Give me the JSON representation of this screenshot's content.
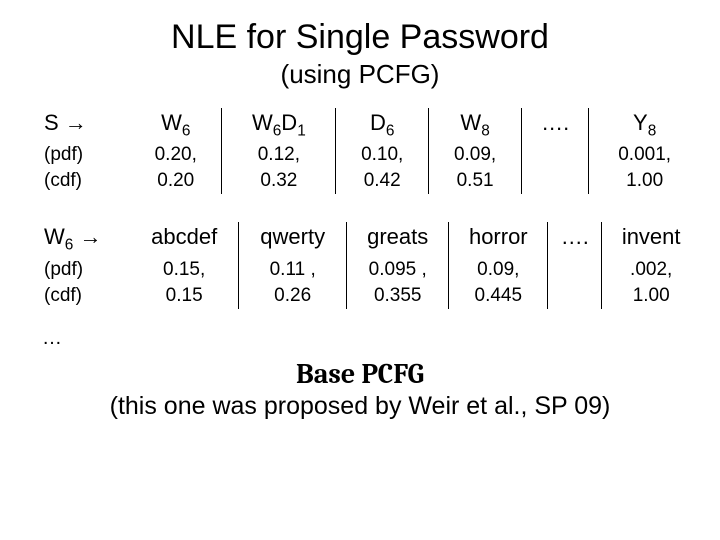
{
  "title": "NLE for Single Password",
  "subtitle": "(using PCFG)",
  "rowA": {
    "label_main": "S →",
    "label_pdf": "(pdf)",
    "label_cdf": "(cdf)",
    "cols": {
      "c1": {
        "head_html": "W<span class=\"sub\">6</span>",
        "pdf": "0.20,",
        "cdf": "0.20"
      },
      "c2": {
        "head_html": "W<span class=\"sub\">6</span>D<span class=\"sub\">1</span>",
        "pdf": "0.12,",
        "cdf": "0.32"
      },
      "c3": {
        "head_html": "D<span class=\"sub\">6</span>",
        "pdf": "0.10,",
        "cdf": "0.42"
      },
      "c4": {
        "head_html": "W<span class=\"sub\">8</span>",
        "pdf": "0.09,",
        "cdf": "0.51"
      },
      "dots": "….",
      "c6": {
        "head_html": "Y<span class=\"sub\">8</span>",
        "pdf": "0.001,",
        "cdf": "1.00"
      }
    }
  },
  "rowB": {
    "label_main_html": "W<span class=\"sub\">6</span> →",
    "label_pdf": "(pdf)",
    "label_cdf": "(cdf)",
    "cols": {
      "c1": {
        "head": "abcdef",
        "pdf": "0.15,",
        "cdf": "0.15"
      },
      "c2": {
        "head": "qwerty",
        "pdf": "0.11 ,",
        "cdf": "0.26"
      },
      "c3": {
        "head": "greats",
        "pdf": "0.095 ,",
        "cdf": "0.355"
      },
      "c4": {
        "head": "horror",
        "pdf": "0.09,",
        "cdf": "0.445"
      },
      "dots": "….",
      "c6": {
        "head": "invent",
        "pdf": ".002,",
        "cdf": "1.00"
      }
    }
  },
  "trailing_dots": "…",
  "footer": {
    "base": "Base PCFG",
    "cred": "(this one was proposed by Weir et al., SP 09)"
  }
}
